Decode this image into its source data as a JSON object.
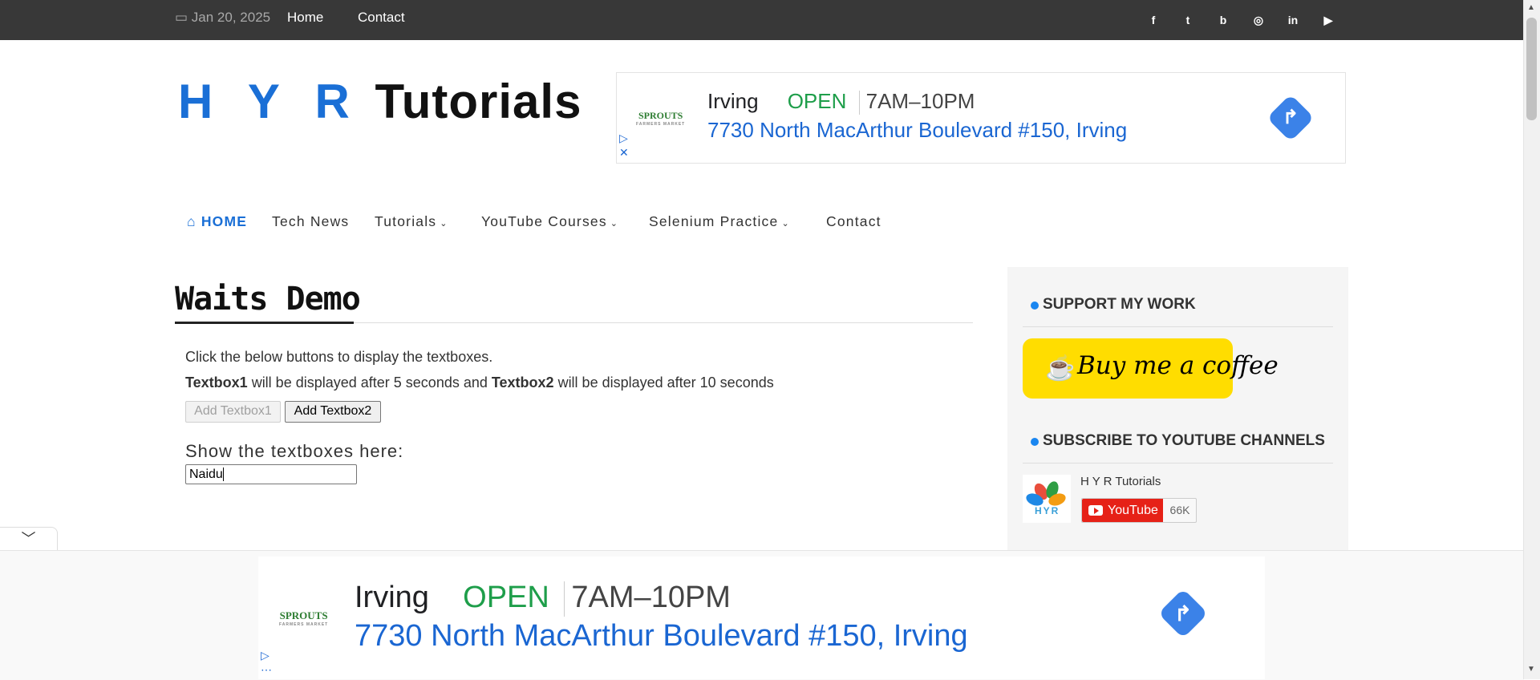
{
  "topbar": {
    "date": "Jan 20, 2025",
    "links": [
      "Home",
      "Contact"
    ],
    "social": [
      {
        "icon": "facebook-icon",
        "glyph": "f"
      },
      {
        "icon": "twitter-icon",
        "glyph": "t"
      },
      {
        "icon": "blogger-icon",
        "glyph": "b"
      },
      {
        "icon": "instagram-icon",
        "glyph": "◎"
      },
      {
        "icon": "linkedin-icon",
        "glyph": "in"
      },
      {
        "icon": "youtube-icon",
        "glyph": "▶"
      }
    ]
  },
  "logo": {
    "part1": "H Y R",
    "part2": "Tutorials"
  },
  "ad": {
    "brand": "SPROUTS",
    "brand_sub": "FARMERS MARKET",
    "city": "Irving",
    "status": "OPEN",
    "hours": "7AM–10PM",
    "address": "7730 North MacArthur Boulevard #150, Irving"
  },
  "nav": {
    "items": [
      "HOME",
      "Tech News",
      "Tutorials",
      "YouTube Courses",
      "Selenium Practice",
      "Contact"
    ]
  },
  "main": {
    "title": "Waits Demo",
    "instruction": "Click the below buttons to display the textboxes.",
    "line2_bold1": "Textbox1",
    "line2_mid": " will be displayed after 5 seconds and ",
    "line2_bold2": "Textbox2",
    "line2_end": " will be displayed after 10 seconds",
    "btn1": "Add Textbox1",
    "btn2": "Add Textbox2",
    "show_label": "Show the textboxes here:",
    "textbox_value": "Naidu"
  },
  "sidebar": {
    "support_heading": "SUPPORT MY WORK",
    "coffee_label": "Buy me a coffee",
    "subscribe_heading": "SUBSCRIBE TO YOUTUBE CHANNELS",
    "channel_name": "H Y R Tutorials",
    "channel_logo_text": "HYR",
    "yt_label": "YouTube",
    "yt_count": "66K"
  },
  "colors": {
    "accent": "#1a6fd6",
    "topbar": "#383838",
    "coffee": "#ffdd00",
    "youtube": "#e62117",
    "open": "#1e9e4a"
  }
}
